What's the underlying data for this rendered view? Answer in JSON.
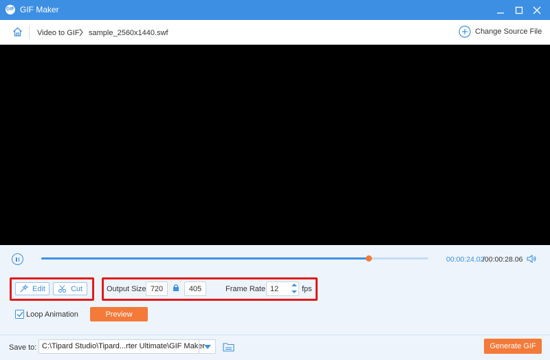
{
  "window": {
    "title": "GIF Maker",
    "app_icon_text": "GIF"
  },
  "breadcrumb": {
    "items": [
      "Video to GIF",
      "sample_2560x1440.swf"
    ]
  },
  "header": {
    "change_source_label": "Change Source File"
  },
  "player": {
    "current_time": "00:00:24.02",
    "total_time": "/00:00:28.06",
    "progress": 0.846
  },
  "tools": {
    "edit_label": "Edit",
    "cut_label": "Cut"
  },
  "output": {
    "size_label": "Output Size:",
    "width": "720",
    "height": "405",
    "frame_rate_label": "Frame Rate:",
    "frame_rate": "12",
    "fps_unit": "fps"
  },
  "options": {
    "loop_label": "Loop Animation",
    "loop_checked": true,
    "preview_label": "Preview"
  },
  "footer": {
    "save_to_label": "Save to:",
    "save_path": "C:\\Tipard Studio\\Tipard...rter Ultimate\\GIF Maker",
    "generate_label": "Generate GIF"
  },
  "colors": {
    "accent": "#3d8fe3",
    "orange": "#f47a3a",
    "highlight_red": "#e01b1b",
    "panel_bg": "#edf4fb"
  }
}
